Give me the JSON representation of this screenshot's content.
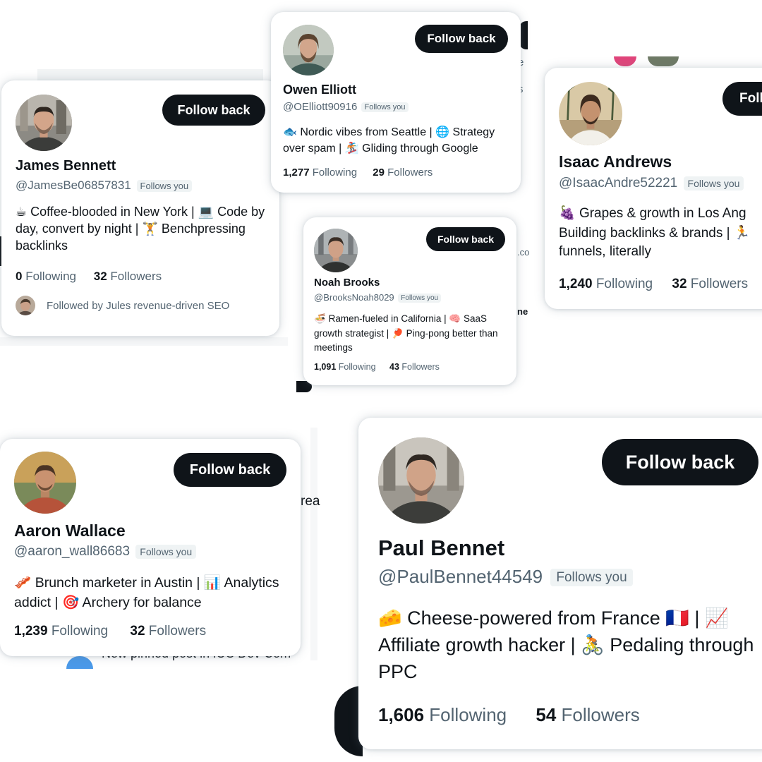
{
  "cards": [
    {
      "name": "James Bennett",
      "handle": "@JamesBe06857831",
      "badge": "Follows you",
      "button": "Follow back",
      "bio": [
        {
          "icon": "coffee-icon",
          "glyph": "☕",
          "text": " Coffee-blooded in New York | "
        },
        {
          "icon": "laptop-icon",
          "glyph": "💻",
          "text": " Code by day, convert by night | "
        },
        {
          "icon": "weightlifter-icon",
          "glyph": "🏋",
          "text": " Benchpressing backlinks"
        }
      ],
      "following_count": "0",
      "following_label": " Following",
      "followers_count": "32",
      "followers_label": " Followers",
      "followed_by": "Followed by Jules revenue-driven SEO"
    },
    {
      "name": "Owen Elliott",
      "handle": "@OElliott90916",
      "badge": "Follows you",
      "button": "Follow back",
      "bio": [
        {
          "icon": "fish-icon",
          "glyph": "🐟",
          "text": " Nordic vibes from Seattle | "
        },
        {
          "icon": "globe-icon",
          "glyph": "🌐",
          "text": " Strategy over spam | "
        },
        {
          "icon": "skier-icon",
          "glyph": "🏂",
          "text": " Gliding through Google"
        }
      ],
      "following_count": "1,277",
      "following_label": " Following",
      "followers_count": "29",
      "followers_label": " Followers"
    },
    {
      "name": "Noah Brooks",
      "handle": "@BrooksNoah8029",
      "badge": "Follows you",
      "button": "Follow back",
      "bio": [
        {
          "icon": "ramen-icon",
          "glyph": "🍜",
          "text": " Ramen-fueled in California | "
        },
        {
          "icon": "brain-icon",
          "glyph": "🧠",
          "text": " SaaS growth strategist | "
        },
        {
          "icon": "ping-pong-icon",
          "glyph": "🏓",
          "text": " Ping-pong better than meetings"
        }
      ],
      "following_count": "1,091",
      "following_label": " Following",
      "followers_count": "43",
      "followers_label": " Followers"
    },
    {
      "name": "Isaac Andrews",
      "handle": "@IsaacAndre52221",
      "badge": "Follows you",
      "button": "Foll",
      "bio": [
        {
          "icon": "grapes-icon",
          "glyph": "🍇",
          "text": " Grapes & growth in Los Ang Building backlinks & brands | "
        },
        {
          "icon": "runner-icon",
          "glyph": "🏃",
          "text": " funnels, literally"
        }
      ],
      "following_count": "1,240",
      "following_label": " Following",
      "followers_count": "32",
      "followers_label": " Followers"
    },
    {
      "name": "Aaron Wallace",
      "handle": "@aaron_wall86683",
      "badge": "Follows you",
      "button": "Follow back",
      "bio": [
        {
          "icon": "bacon-icon",
          "glyph": "🥓",
          "text": " Brunch marketer in Austin | "
        },
        {
          "icon": "bar-chart-icon",
          "glyph": "📊",
          "text": " Analytics addict | "
        },
        {
          "icon": "target-icon",
          "glyph": "🎯",
          "text": " Archery for balance"
        }
      ],
      "following_count": "1,239",
      "following_label": " Following",
      "followers_count": "32",
      "followers_label": " Followers"
    },
    {
      "name": "Paul Bennet",
      "handle": "@PaulBennet44549",
      "badge": "Follows you",
      "button": "Follow back",
      "bio": [
        {
          "icon": "cheese-icon",
          "glyph": "🧀",
          "text": " Cheese-powered from France "
        },
        {
          "icon": "france-flag-icon",
          "glyph": "🇫🇷",
          "text": " | "
        },
        {
          "icon": "chart-up-icon",
          "glyph": "📈",
          "text": " Affiliate growth hacker | "
        },
        {
          "icon": "cyclist-icon",
          "glyph": "🚴",
          "text": " Pedaling through PPC"
        }
      ],
      "following_count": "1,606",
      "following_label": " Following",
      "followers_count": "54",
      "followers_label": " Followers"
    }
  ],
  "background": {
    "pinned_post": "New pinned post in iOS Dev Com",
    "fragment_rea": "rea",
    "fragment_e": "e",
    "fragment_s": "s",
    "fragment_co": ".co",
    "fragment_ne": "ne"
  },
  "colors": {
    "button_bg": "#0f1419",
    "secondary_text": "#536471",
    "badge_bg": "#eff3f4"
  }
}
